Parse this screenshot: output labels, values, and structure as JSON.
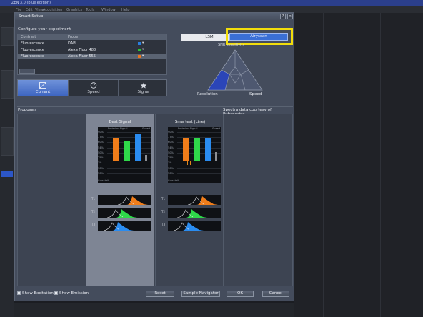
{
  "app": {
    "title": "ZEN 3.0 (blue edition)",
    "menu": [
      "File",
      "Edit",
      "View",
      "Acquisition",
      "Graphics",
      "Tools",
      "Window",
      "Help"
    ]
  },
  "dialog": {
    "title": "Smart Setup",
    "help_label": "?",
    "close_label": "×",
    "configure_label": "Configure your experiment",
    "table": {
      "headers": [
        "Contrast",
        "Probe"
      ],
      "rows": [
        {
          "contrast": "Fluorescence",
          "probe": "DAPI",
          "color": "#2a7fe0"
        },
        {
          "contrast": "Fluorescence",
          "probe": "Alexa Fluor 488",
          "color": "#29c63a"
        },
        {
          "contrast": "Fluorescence",
          "probe": "Alexa Fluor 555",
          "color": "#e8761c"
        }
      ],
      "arrow": "▾"
    },
    "modes": {
      "lsm": "LSM",
      "airyscan": "Airyscan"
    },
    "sns_label": "SNR sensitivity",
    "triangle": {
      "resolution": "Resolution",
      "speed": "Speed"
    },
    "strategies": [
      {
        "label": "Current",
        "icon": "current-icon"
      },
      {
        "label": "Speed",
        "icon": "speed-icon"
      },
      {
        "label": "Signal",
        "icon": "signal-icon"
      }
    ],
    "proposals_label": "Proposals",
    "spectra_credit": "Spectra data courtesy of Pubspectra",
    "proposal_columns": [
      {
        "title": "Best Signal"
      },
      {
        "title": "Smartest (Line)"
      }
    ],
    "chart_labels": {
      "emission": "Emission Signal",
      "speed": "Speed",
      "crosstalk": "Crosstalk"
    },
    "pct_ticks": [
      "90%",
      "77%",
      "60%",
      "54%",
      "50%",
      "25%",
      "3%",
      "30%",
      "50%"
    ],
    "track_tags": [
      "T1",
      "T2",
      "T3"
    ],
    "show_excitation": "Show Excitation",
    "show_emission": "Show Emission",
    "buttons": {
      "reset": "Reset",
      "navigator": "Sample Navigator",
      "ok": "OK",
      "cancel": "Cancel"
    }
  },
  "colors": {
    "accent": "#3a6fd6",
    "highlight": "#f2dd0c",
    "orange": "#f07d1a",
    "green": "#2fd84a",
    "blue": "#2a8cf0"
  },
  "chart_data": [
    {
      "type": "bar",
      "title": "Best Signal",
      "categories": [
        "Alexa Fluor 555",
        "Alexa Fluor 488",
        "DAPI",
        "Speed"
      ],
      "values": [
        77,
        65,
        90,
        20
      ],
      "ylim": [
        0,
        100
      ]
    },
    {
      "type": "bar",
      "title": "Smartest (Line)",
      "categories": [
        "Alexa Fluor 555",
        "Alexa Fluor 488",
        "DAPI",
        "Speed"
      ],
      "values": [
        77,
        77,
        77,
        30
      ],
      "ylim": [
        0,
        100
      ]
    }
  ]
}
